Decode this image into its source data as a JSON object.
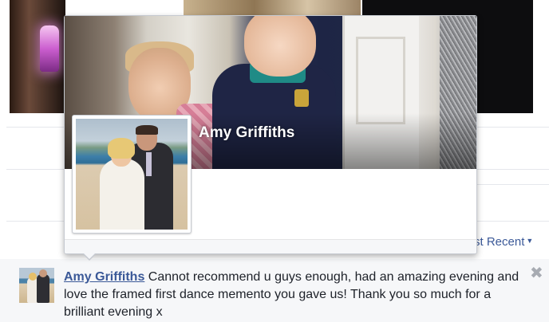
{
  "hovercard": {
    "name": "Amy Griffiths"
  },
  "feed": {
    "sort_label": "st Recent",
    "sort_caret": "▼"
  },
  "comment": {
    "author": "Amy Griffiths",
    "text": " Cannot recommend u guys enough, had an amazing evening and love the framed first dance memento you gave us! Thank you so much for a brilliant evening x",
    "close_glyph": "✖"
  },
  "colors": {
    "link": "#3b5998",
    "text": "#1d2129",
    "muted": "#a7abb2"
  }
}
